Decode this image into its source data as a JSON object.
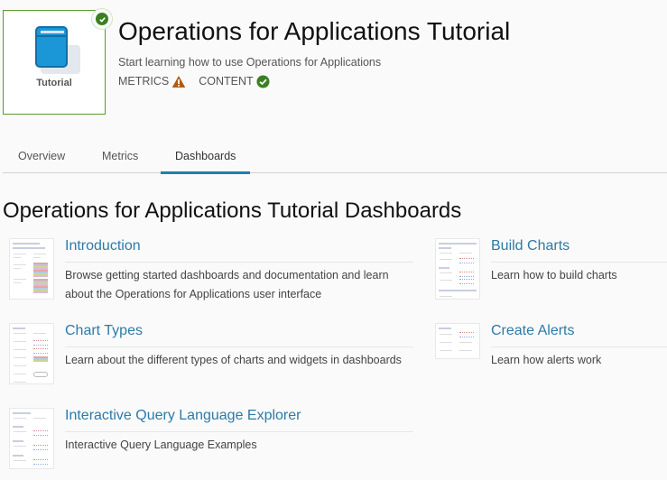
{
  "app": {
    "logo_label": "Tutorial",
    "title": "Operations for Applications Tutorial",
    "subtitle": "Start learning how to use Operations for Applications",
    "status": [
      {
        "label": "METRICS",
        "icon": "warning-icon",
        "color": "#b05b13"
      },
      {
        "label": "CONTENT",
        "icon": "check-circle-icon",
        "color": "#3b7f22"
      }
    ],
    "installed_badge_icon": "check-circle-icon"
  },
  "tabs": [
    {
      "label": "Overview",
      "active": false
    },
    {
      "label": "Metrics",
      "active": false
    },
    {
      "label": "Dashboards",
      "active": true
    }
  ],
  "section": {
    "title": "Operations for Applications Tutorial Dashboards"
  },
  "dashboards": [
    {
      "title": "Introduction",
      "description": "Browse getting started dashboards and documentation and learn about the Operations for Applications user interface"
    },
    {
      "title": "Build Charts",
      "description": "Learn how to build charts"
    },
    {
      "title": "Chart Types",
      "description": "Learn about the different types of charts and widgets in dashboards"
    },
    {
      "title": "Create Alerts",
      "description": "Learn how alerts work"
    },
    {
      "title": "Interactive Query Language Explorer",
      "description": "Interactive Query Language Examples"
    }
  ],
  "colors": {
    "accent": "#1f7fae",
    "link": "#2e7aa8",
    "success": "#3b7f22",
    "warning": "#b05b13",
    "card_border": "#5a9b2c"
  }
}
